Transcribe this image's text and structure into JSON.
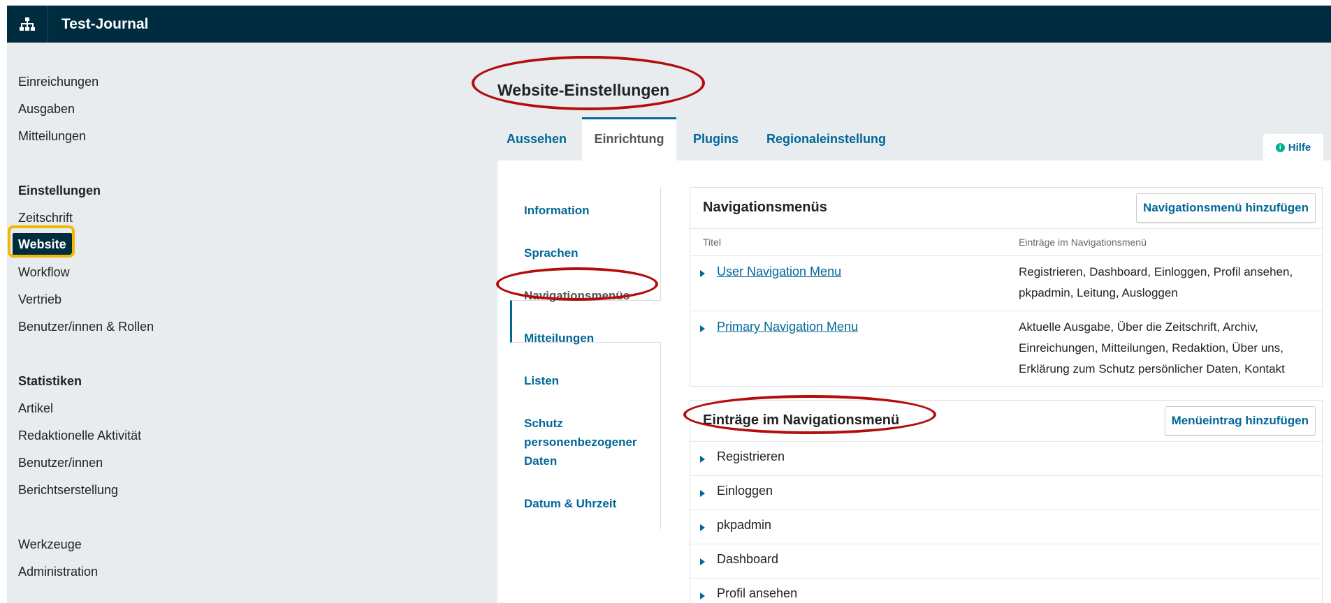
{
  "app": {
    "title": "Test-Journal",
    "home_icon": "sitemap-icon"
  },
  "sidebar": {
    "nav_items": [
      "Einreichungen",
      "Ausgaben",
      "Mitteilungen"
    ],
    "settings_heading": "Einstellungen",
    "settings_items": [
      "Zeitschrift",
      "Website",
      "Workflow",
      "Vertrieb",
      "Benutzer/innen & Rollen"
    ],
    "active_item": "Website",
    "stats_heading": "Statistiken",
    "stats_items": [
      "Artikel",
      "Redaktionelle Aktivität",
      "Benutzer/innen",
      "Berichtserstellung"
    ],
    "tool_items": [
      "Werkzeuge",
      "Administration"
    ]
  },
  "page": {
    "title": "Website-Einstellungen",
    "tabs": [
      "Aussehen",
      "Einrichtung",
      "Plugins",
      "Regionaleinstellung"
    ],
    "active_tab": "Einrichtung",
    "help_label": "Hilfe"
  },
  "subnav": {
    "items": [
      "Information",
      "Sprachen",
      "Navigationsmenüs",
      "Mitteilungen",
      "Listen",
      "Schutz personenbezogener Daten",
      "Datum & Uhrzeit"
    ],
    "active": "Navigationsmenüs"
  },
  "nav_menus": {
    "title": "Navigationsmenüs",
    "add_button": "Navigationsmenü hinzufügen",
    "columns": [
      "Titel",
      "Einträge im Navigationsmenü"
    ],
    "rows": [
      {
        "title": "User Navigation Menu",
        "items": "Registrieren, Dashboard, Einloggen, Profil ansehen, pkpadmin, Leitung, Ausloggen"
      },
      {
        "title": "Primary Navigation Menu",
        "items": "Aktuelle Ausgabe, Über die Zeitschrift, Archiv, Einreichungen, Mitteilungen, Redaktion, Über uns, Erklärung zum Schutz persönlicher Daten, Kontakt"
      }
    ]
  },
  "menu_entries": {
    "title": "Einträge im Navigationsmenü",
    "add_button": "Menüeintrag hinzufügen",
    "items": [
      "Registrieren",
      "Einloggen",
      "pkpadmin",
      "Dashboard",
      "Profil ansehen"
    ]
  },
  "colors": {
    "header": "#002c40",
    "link": "#006798",
    "highlight_red": "#b30d0d",
    "highlight_yellow": "#f5b600"
  }
}
